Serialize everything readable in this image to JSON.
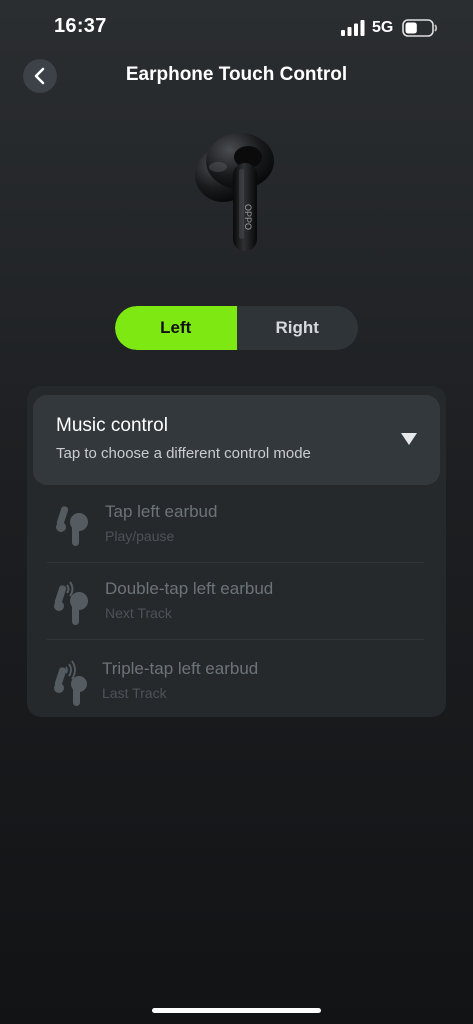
{
  "status_bar": {
    "time": "16:37",
    "network": "5G",
    "signal_bars": 4,
    "battery_level": 0.45
  },
  "header": {
    "title": "Earphone Touch Control",
    "back_icon": "chevron-left-icon"
  },
  "earbud_image": {
    "brand_text": "OPPO"
  },
  "segmented_control": {
    "options": [
      "Left",
      "Right"
    ],
    "selected": "Left"
  },
  "mode": {
    "title": "Music control",
    "subtitle": "Tap to choose a different control mode"
  },
  "gestures": [
    {
      "title": "Tap left earbud",
      "action": "Play/pause",
      "icon": "tap-earbud-icon"
    },
    {
      "title": "Double-tap left earbud",
      "action": "Next Track",
      "icon": "double-tap-earbud-icon"
    },
    {
      "title": "Triple-tap left earbud",
      "action": "Last Track",
      "icon": "triple-tap-earbud-icon"
    }
  ],
  "colors": {
    "accent": "#7ee813",
    "background": "#1d1f22",
    "card": "#25292c",
    "selector": "#32383c"
  }
}
